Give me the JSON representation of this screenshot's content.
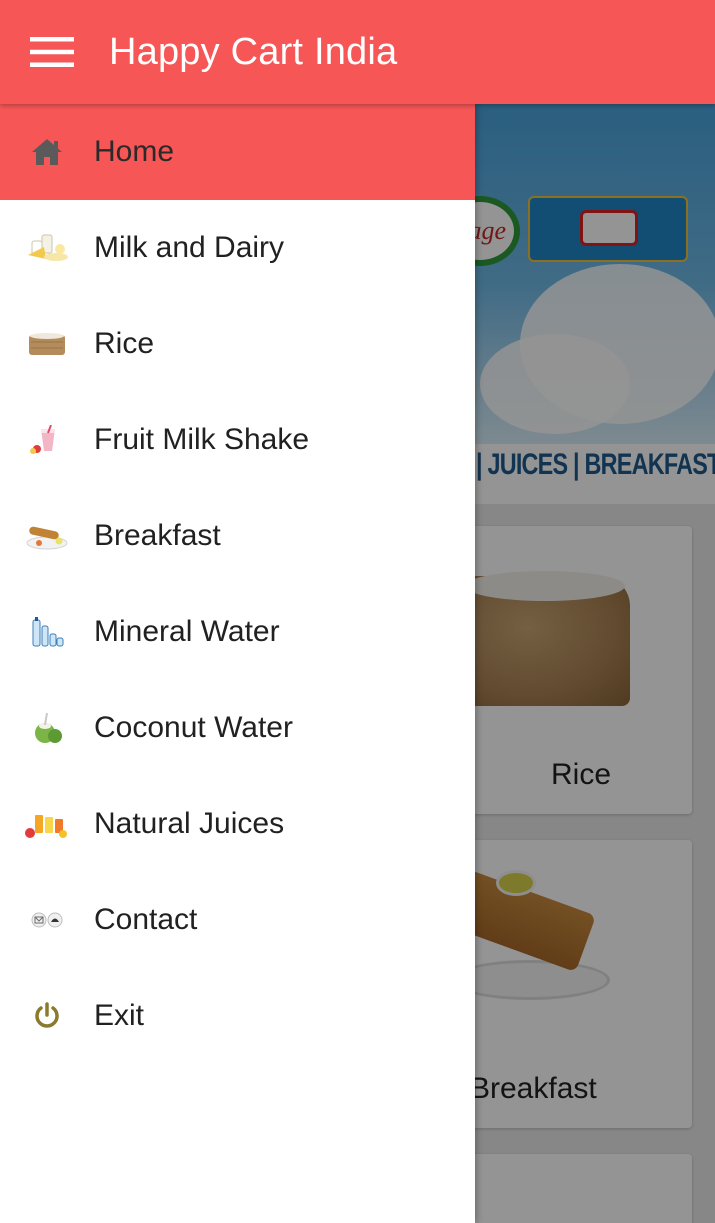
{
  "app_bar": {
    "title": "Happy Cart India",
    "menu_icon": "hamburger-menu-icon"
  },
  "navigation_drawer": {
    "items": [
      {
        "label": "Home",
        "icon": "home-icon",
        "active": true
      },
      {
        "label": "Milk and Dairy",
        "icon": "milk-dairy-icon",
        "active": false
      },
      {
        "label": "Rice",
        "icon": "rice-sack-icon",
        "active": false
      },
      {
        "label": "Fruit Milk Shake",
        "icon": "milkshake-icon",
        "active": false
      },
      {
        "label": "Breakfast",
        "icon": "breakfast-dosa-icon",
        "active": false
      },
      {
        "label": "Mineral Water",
        "icon": "water-bottles-icon",
        "active": false
      },
      {
        "label": "Coconut Water",
        "icon": "coconut-icon",
        "active": false
      },
      {
        "label": "Natural Juices",
        "icon": "juices-icon",
        "active": false
      },
      {
        "label": "Contact",
        "icon": "contact-icon",
        "active": false
      },
      {
        "label": "Exit",
        "icon": "power-icon",
        "active": false
      }
    ]
  },
  "background_content": {
    "banner": {
      "logo_text": "age",
      "tagline": "| JUICES | BREAKFAST"
    },
    "cards": [
      {
        "label": "Rice"
      },
      {
        "label": "Breakfast"
      }
    ]
  },
  "colors": {
    "primary": "#f65656",
    "drawer_background": "#ffffff",
    "text": "#212121",
    "exit_icon": "#8a7a2e"
  }
}
